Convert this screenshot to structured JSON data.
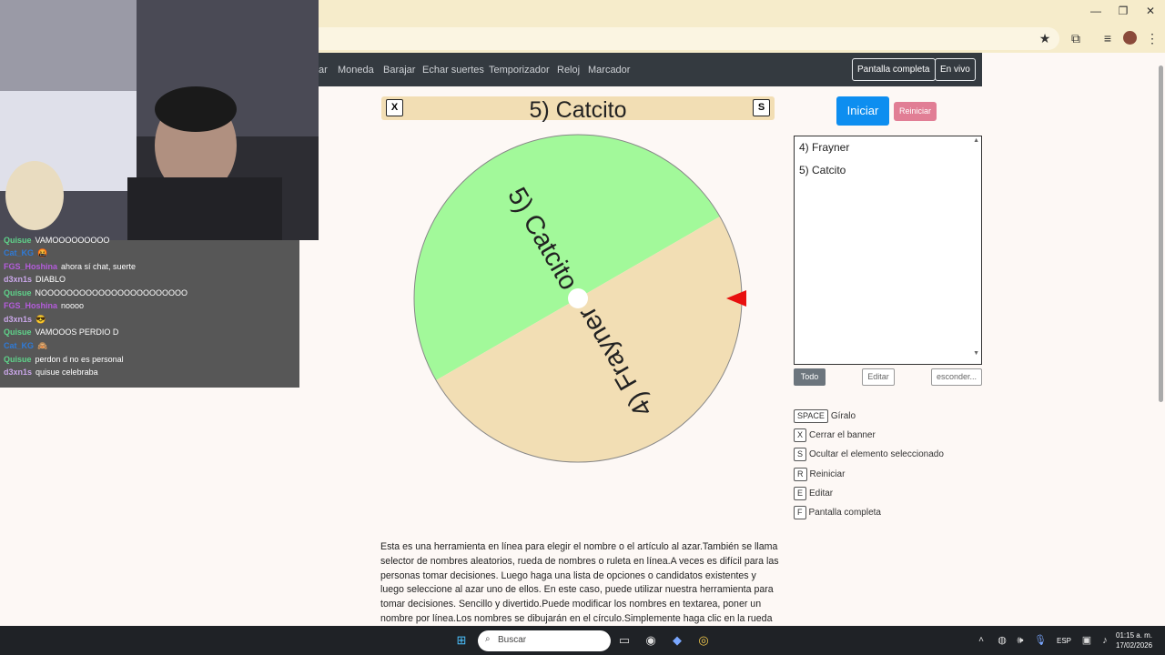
{
  "browser": {
    "minimize_icon": "minimize-icon",
    "maximize_icon": "restore-icon",
    "close_icon": "close-icon"
  },
  "nav": {
    "items": [
      "ar",
      "Moneda",
      "Barajar",
      "Echar suertes",
      "Temporizador",
      "Reloj",
      "Marcador"
    ],
    "fullscreen": "Pantalla completa",
    "live": "En vivo"
  },
  "banner": {
    "close_key": "X",
    "title": "5) Catcito",
    "hide_key": "S"
  },
  "wheel": {
    "segments": [
      {
        "label": "4) Frayner",
        "color": "#a2f99a"
      },
      {
        "label": "5) Catcito",
        "color": "#f2deb4"
      }
    ],
    "pointer_color": "#e8100f"
  },
  "controls": {
    "start": "Iniciar",
    "reset": "Reiniciar",
    "names": [
      "4) Frayner",
      "5) Catcito"
    ],
    "btn_all": "Todo",
    "btn_edit": "Editar",
    "btn_hide": "esconder..."
  },
  "shortcuts": [
    {
      "key": "SPACE",
      "label": "Gíralo"
    },
    {
      "key": "X",
      "label": "Cerrar el banner"
    },
    {
      "key": "S",
      "label": "Ocultar el elemento seleccionado"
    },
    {
      "key": "R",
      "label": "Reiniciar"
    },
    {
      "key": "E",
      "label": "Editar"
    },
    {
      "key": "F",
      "label": "Pantalla completa"
    }
  ],
  "description": "Esta es una herramienta en línea para elegir el nombre o el artículo al azar.También se llama selector de nombres aleatorios, rueda de nombres o ruleta en línea.A veces es difícil para las personas tomar decisiones. Luego haga una lista de opciones o candidatos existentes y luego seleccione al azar uno de ellos. En este caso, puede utilizar nuestra herramienta para tomar decisiones. Sencillo y divertido.Puede modificar los nombres en textarea, poner un nombre por línea.Los nombres se dibujarán en el círculo.Simplemente haga clic en la rueda",
  "chat": [
    {
      "user": "Quisue",
      "color": "#5fd38a",
      "msg": "VAMOOOOOOOOO"
    },
    {
      "user": "Cat_KG",
      "color": "#2f7ad6",
      "msg": "🤬"
    },
    {
      "user": "FGS_Hoshina",
      "color": "#b45cdb",
      "msg": "ahora sí chat, suerte"
    },
    {
      "user": "d3xn1s",
      "color": "#c9a6e8",
      "msg": "DIABLO"
    },
    {
      "user": "Quisue",
      "color": "#5fd38a",
      "msg": "NOOOOOOOOOOOOOOOOOOOOOOO"
    },
    {
      "user": "FGS_Hoshina",
      "color": "#b45cdb",
      "msg": "noooo"
    },
    {
      "user": "d3xn1s",
      "color": "#c9a6e8",
      "msg": "😎"
    },
    {
      "user": "Quisue",
      "color": "#5fd38a",
      "msg": "VAMOOOS PERDIO D"
    },
    {
      "user": "Cat_KG",
      "color": "#2f7ad6",
      "msg": "🙈"
    },
    {
      "user": "Quisue",
      "color": "#5fd38a",
      "msg": "perdon d no es personal"
    },
    {
      "user": "d3xn1s",
      "color": "#c9a6e8",
      "msg": "quisue celebraba"
    }
  ],
  "taskbar": {
    "search": "Buscar",
    "lang": "ESP",
    "time": "01:15 a. m.",
    "date": "17/02/2026"
  }
}
